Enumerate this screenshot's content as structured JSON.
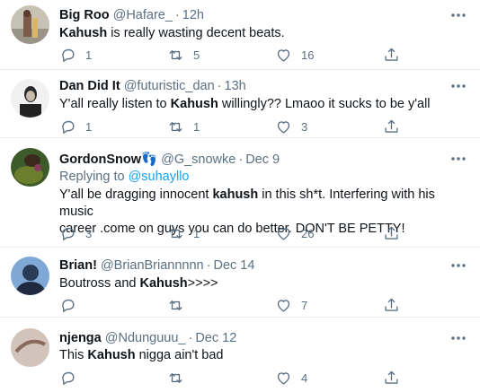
{
  "tweets": [
    {
      "name": "Big Roo",
      "handle": "@Hafare_",
      "time": "12h",
      "text_parts": [
        "Kahush",
        " is really wasting decent beats."
      ],
      "reply_count": "1",
      "retweet_count": "5",
      "like_count": "16"
    },
    {
      "name": "Dan Did It",
      "handle": "@futuristic_dan",
      "time": "13h",
      "text_parts": [
        "Y'all really listen to ",
        "Kahush",
        " willingly?? Lmaoo it sucks to be y'all"
      ],
      "reply_count": "1",
      "retweet_count": "1",
      "like_count": "3"
    },
    {
      "name": "GordonSnow",
      "name_emoji": "👣",
      "handle": "@G_snowke",
      "time": "Dec 9",
      "replying_to_label": "Replying to",
      "replying_to_handle": "@suhayllo",
      "text_parts": [
        "Y'all be dragging innocent ",
        "kahush",
        " in this sh*t.  Interfering with his music",
        "career .come on guys you can do better. DON'T BE PETTY!"
      ],
      "reply_count": "3",
      "retweet_count": "1",
      "like_count": "26"
    },
    {
      "name": "Brian!",
      "handle": "@BrianBriannnnn",
      "time": "Dec 14",
      "text_parts": [
        "Boutross and ",
        "Kahush",
        ">>>>"
      ],
      "reply_count": "",
      "retweet_count": "",
      "like_count": "7"
    },
    {
      "name": "njenga",
      "handle": "@Ndunguuu_",
      "time": "Dec 12",
      "text_parts": [
        "This ",
        "Kahush",
        " nigga ain't  bad"
      ],
      "reply_count": "",
      "retweet_count": "",
      "like_count": "4"
    }
  ],
  "dot": "·",
  "colors": {
    "accent": "#1da1f2",
    "secondary": "#5b7083",
    "border": "#e6ecf0"
  },
  "icons": [
    "reply-icon",
    "retweet-icon",
    "like-icon",
    "share-icon",
    "more-icon"
  ]
}
